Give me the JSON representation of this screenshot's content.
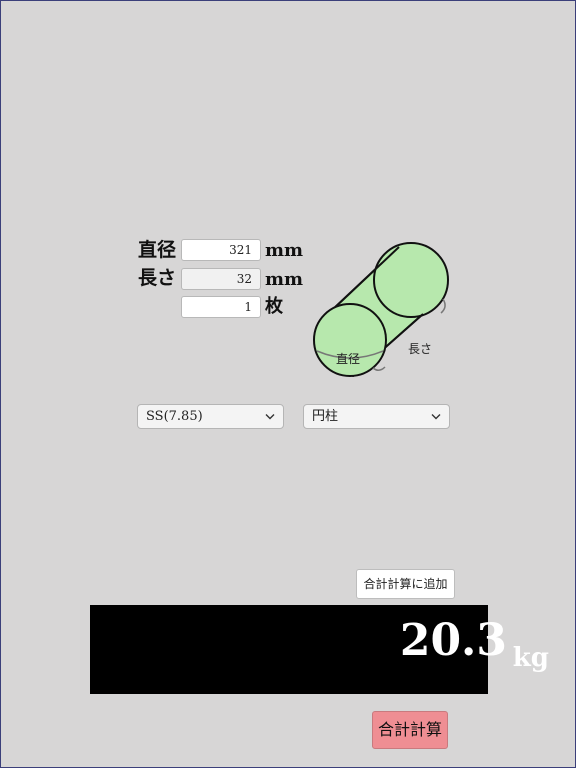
{
  "form": {
    "diameter": {
      "label": "直径",
      "value": "321",
      "unit": "mm"
    },
    "length": {
      "label": "長さ",
      "value": "32",
      "unit": "mm"
    },
    "count": {
      "label": "",
      "value": "1",
      "unit": "枚"
    }
  },
  "diagram": {
    "diameter_label": "直径",
    "length_label": "長さ",
    "fill_color": "#b7e8ad"
  },
  "material_select": {
    "selected": "SS(7.85)"
  },
  "shape_select": {
    "selected": "円柱"
  },
  "add_button": {
    "label": "合計計算に追加"
  },
  "result": {
    "value": "20.3",
    "unit": "kg"
  },
  "total_button": {
    "label": "合計計算"
  }
}
